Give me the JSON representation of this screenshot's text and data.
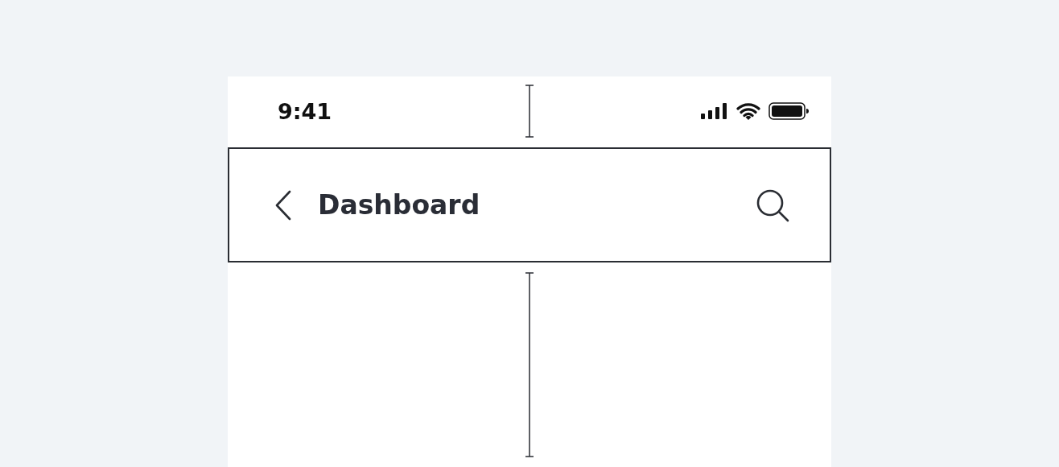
{
  "status_bar": {
    "time": "9:41"
  },
  "header": {
    "title": "Dashboard"
  }
}
